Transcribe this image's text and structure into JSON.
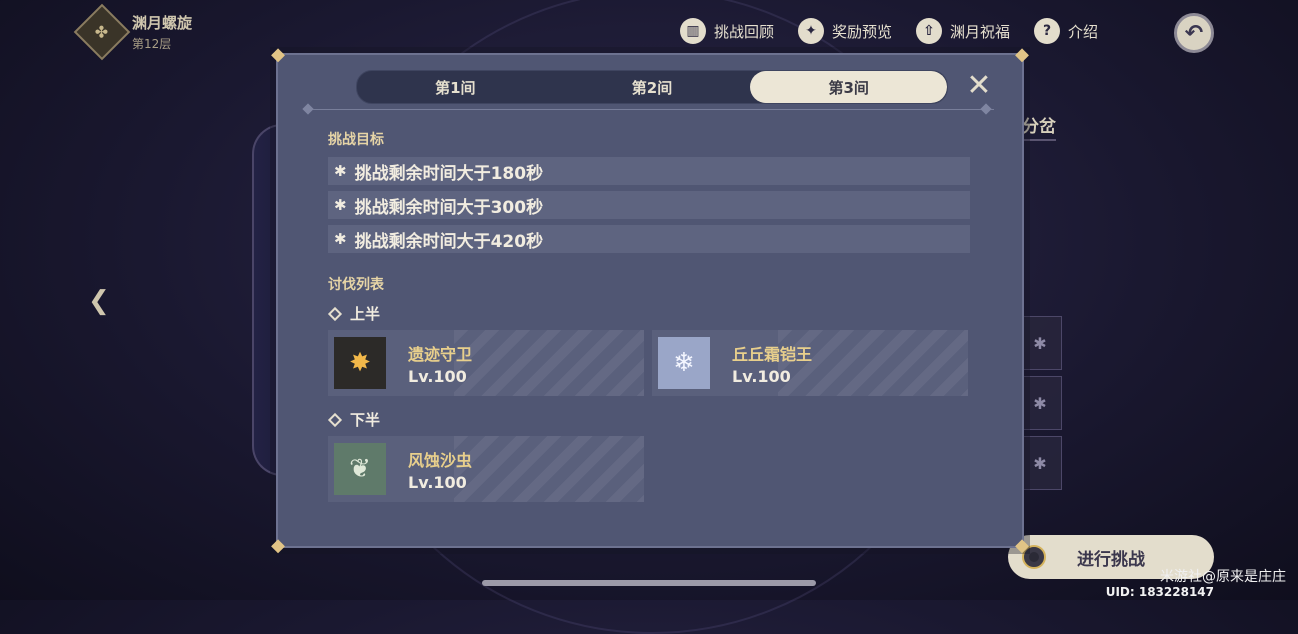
{
  "header": {
    "title": "渊月螺旋",
    "floor": "第12层",
    "emblem": "abyss-emblem-icon"
  },
  "topnav": [
    {
      "label": "挑战回顾",
      "icon": "book-icon",
      "glyph": "▥"
    },
    {
      "label": "奖励预览",
      "icon": "star-reward-icon",
      "glyph": "✦"
    },
    {
      "label": "渊月祝福",
      "icon": "upgrade-arrow-icon",
      "glyph": "⇧"
    },
    {
      "label": "介绍",
      "icon": "question-icon",
      "glyph": "?"
    }
  ],
  "background": {
    "branch_label": "分岔",
    "start_button": "进行挑战"
  },
  "modal": {
    "tabs": [
      {
        "label": "第1间",
        "active": false
      },
      {
        "label": "第2间",
        "active": false
      },
      {
        "label": "第3间",
        "active": true
      }
    ],
    "goals_title": "挑战目标",
    "goals": [
      "挑战剩余时间大于180秒",
      "挑战剩余时间大于300秒",
      "挑战剩余时间大于420秒"
    ],
    "enemies_title": "讨伐列表",
    "halves": [
      {
        "label": "上半",
        "enemies": [
          {
            "name": "遗迹守卫",
            "level": "Lv.100",
            "icon": "ruin-guard-icon",
            "color": "#2c2a28"
          },
          {
            "name": "丘丘霜铠王",
            "level": "Lv.100",
            "icon": "frost-lawachurl-icon",
            "color": "#9aa6c8"
          }
        ]
      },
      {
        "label": "下半",
        "enemies": [
          {
            "name": "风蚀沙虫",
            "level": "Lv.100",
            "icon": "sand-worm-icon",
            "color": "#5f7a6a"
          }
        ]
      }
    ]
  },
  "watermark": "米游社@原来是庄庄",
  "uid": "UID: 183228147",
  "colors": {
    "accent_gold": "#e1c486",
    "modal_bg": "#505673",
    "tab_active": "#ece6d6"
  }
}
